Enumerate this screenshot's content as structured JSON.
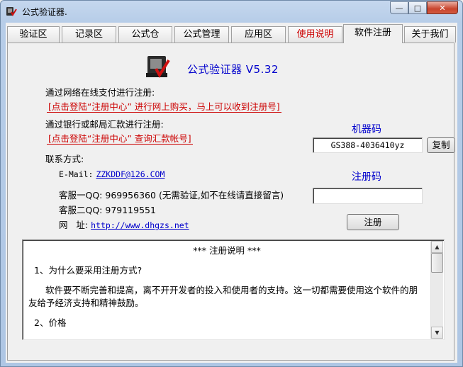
{
  "window": {
    "title": "公式验证器."
  },
  "tabs": [
    {
      "label": "验证区"
    },
    {
      "label": "记录区"
    },
    {
      "label": "公式仓"
    },
    {
      "label": "公式管理"
    },
    {
      "label": "应用区"
    },
    {
      "label": "使用说明"
    },
    {
      "label": "软件注册"
    },
    {
      "label": "关于我们"
    }
  ],
  "register": {
    "app_name": "公式验证器 V5.32",
    "online_label": "通过网络在线支付进行注册:",
    "online_link": "[点击登陆“注册中心” 进行网上购买，马上可以收到注册号]",
    "bank_label": "通过银行或邮局汇款进行注册:",
    "bank_link": "[点击登陆“注册中心” 查询汇款帐号]",
    "contact_label": "联系方式:",
    "email_label": "E-Mail:",
    "email_value": "ZZKDDF@126.COM",
    "qq1_label": "客服一QQ:",
    "qq1_value": "969956360",
    "qq1_note": "(无需验证,如不在线请直接留言)",
    "qq2_label": "客服二QQ:",
    "qq2_value": "979119551",
    "site_label": "网   址:",
    "site_value": "http://www.dhgzs.net",
    "machine_code_label": "机器码",
    "machine_code_value": "GS388-4036410yz",
    "copy_button": "复制",
    "reg_code_label": "注册码",
    "reg_code_value": "",
    "register_button": "注册"
  },
  "memo": {
    "title": "*** 注册说明 ***",
    "q1": "1、为什么要采用注册方式?",
    "a1": "软件要不断完善和提高，离不开开发者的投入和使用者的支持。这一切都需要使用这个软件的朋友给予经济支持和精神鼓励。",
    "q2": "2、价格"
  }
}
